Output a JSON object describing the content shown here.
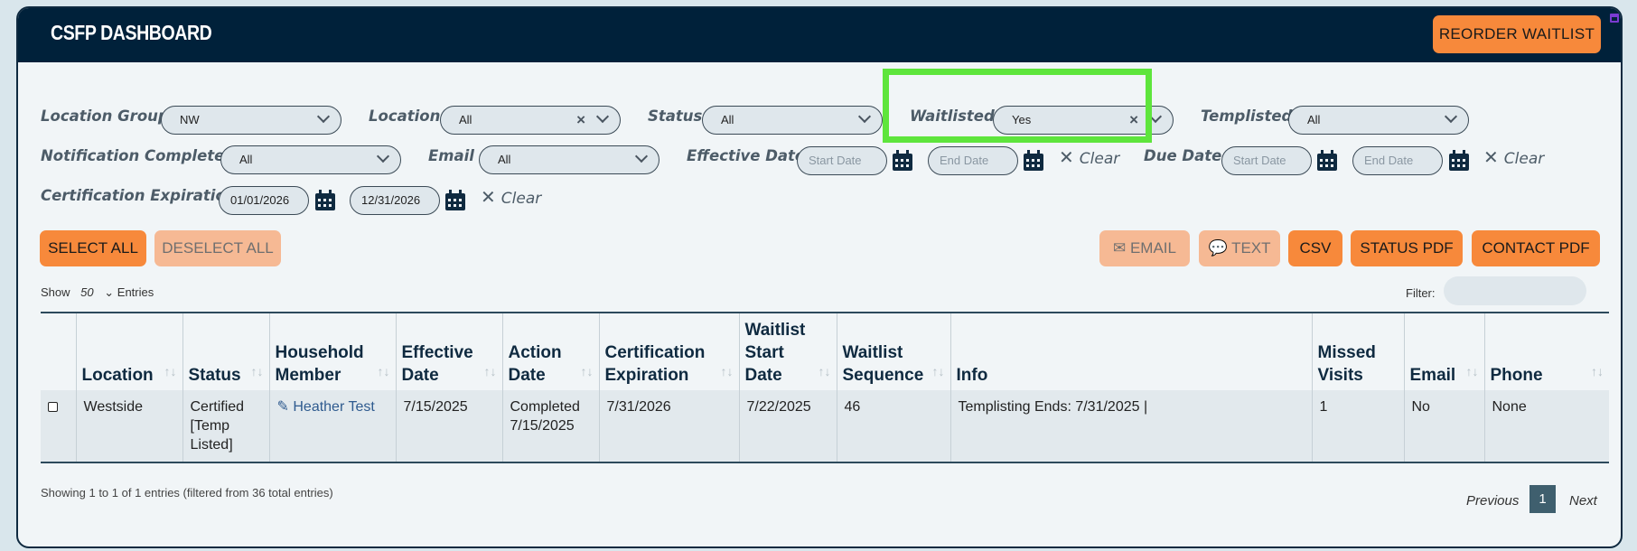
{
  "header": {
    "brand": "CSFP DASHBOARD",
    "reorder_label": "REORDER WAITLIST"
  },
  "filters": {
    "location_group": {
      "label": "Location Group",
      "value": "NW"
    },
    "location": {
      "label": "Location",
      "value": "All"
    },
    "status": {
      "label": "Status",
      "value": "All"
    },
    "waitlisted": {
      "label": "Waitlisted",
      "value": "Yes"
    },
    "templisted": {
      "label": "Templisted",
      "value": "All"
    },
    "notification_completed": {
      "label": "Notification Completed",
      "value": "All"
    },
    "email": {
      "label": "Email",
      "value": "All"
    },
    "effective_date": {
      "label": "Effective Date",
      "start_placeholder": "Start Date",
      "end_placeholder": "End Date"
    },
    "due_date": {
      "label": "Due Date",
      "start_placeholder": "Start Date",
      "end_placeholder": "End Date"
    },
    "certification_expiration": {
      "label": "Certification Expiration",
      "start": "01/01/2026",
      "end": "12/31/2026"
    },
    "clear_label": "Clear"
  },
  "actions": {
    "select_all": "SELECT ALL",
    "deselect_all": "DESELECT ALL",
    "email": "EMAIL",
    "text": "TEXT",
    "csv": "CSV",
    "status_pdf": "STATUS PDF",
    "contact_pdf": "CONTACT PDF"
  },
  "table_controls": {
    "show": "Show",
    "entries_count": "50",
    "entries": "Entries",
    "filter": "Filter:"
  },
  "table": {
    "headers": [
      [
        "Location"
      ],
      [
        "Status"
      ],
      [
        "Household",
        "Member"
      ],
      [
        "Effective",
        "Date"
      ],
      [
        "Action",
        "Date"
      ],
      [
        "Certification",
        "Expiration"
      ],
      [
        "Waitlist",
        "Start",
        "Date"
      ],
      [
        "Waitlist",
        "Sequence"
      ],
      [
        "Info"
      ],
      [
        "Missed",
        "Visits"
      ],
      [
        "Email"
      ],
      [
        "Phone"
      ]
    ],
    "rows": [
      {
        "location": "Westside",
        "status": [
          "Certified",
          "[Temp",
          "Listed]"
        ],
        "member": "Heather Test",
        "effective_date": "7/15/2025",
        "action_date": [
          "Completed",
          "7/15/2025"
        ],
        "cert_expiration": "7/31/2026",
        "waitlist_start": "7/22/2025",
        "waitlist_sequence": "46",
        "info": "Templisting Ends: 7/31/2025 |",
        "missed_visits": "1",
        "email": "No",
        "phone": "None"
      }
    ]
  },
  "footer": {
    "info": "Showing 1 to 1 of 1 entries (filtered from 36 total entries)",
    "previous": "Previous",
    "page": "1",
    "next": "Next"
  },
  "colors": {
    "header_bg": "#00213a",
    "accent": "#f7893b",
    "highlight": "#5ee53c"
  }
}
